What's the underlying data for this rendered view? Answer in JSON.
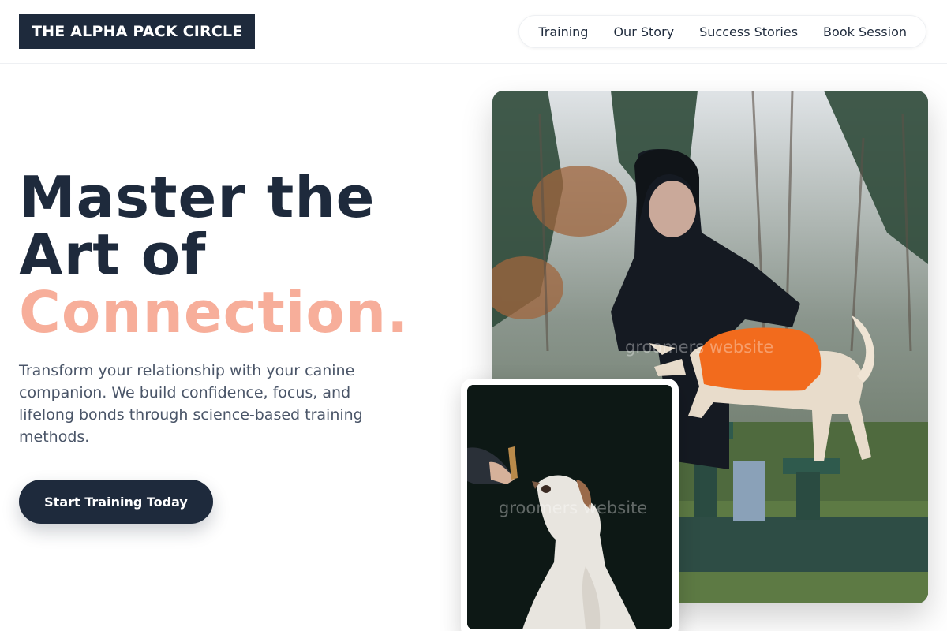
{
  "header": {
    "logo": "THE ALPHA PACK CIRCLE",
    "nav": [
      {
        "label": "Training"
      },
      {
        "label": "Our Story"
      },
      {
        "label": "Success Stories"
      },
      {
        "label": "Book Session"
      }
    ]
  },
  "hero": {
    "title_line1": "Master the",
    "title_line2": "Art of",
    "title_accent": "Connection.",
    "description": "Transform your relationship with your canine companion. We build confidence, focus, and lifelong bonds through science-based training methods.",
    "cta_label": "Start Training Today"
  },
  "images": {
    "main_watermark": "groomers website",
    "inset_watermark": "groomers website"
  },
  "colors": {
    "navy": "#1e2a3c",
    "accent": "#f7ae9a",
    "vest": "#f26b1d"
  }
}
